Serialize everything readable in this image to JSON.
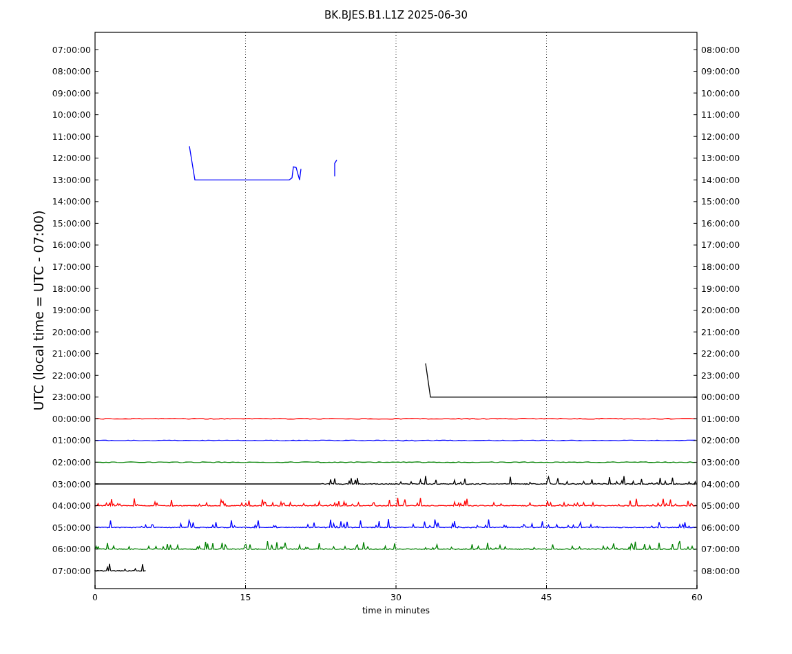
{
  "title": "BK.BJES.B1.L1Z 2025-06-30",
  "ylabel": "UTC (local time = UTC - 07:00)",
  "xlabel": "time in minutes",
  "xticks": [
    "0",
    "15",
    "30",
    "45",
    "60"
  ],
  "rows": [
    {
      "left": "07:00:00",
      "right": "08:00:00"
    },
    {
      "left": "08:00:00",
      "right": "09:00:00"
    },
    {
      "left": "09:00:00",
      "right": "10:00:00"
    },
    {
      "left": "10:00:00",
      "right": "11:00:00"
    },
    {
      "left": "11:00:00",
      "right": "12:00:00"
    },
    {
      "left": "12:00:00",
      "right": "13:00:00"
    },
    {
      "left": "13:00:00",
      "right": "14:00:00",
      "trace": {
        "kind": "drop-segment",
        "color": "#0000ff"
      }
    },
    {
      "left": "14:00:00",
      "right": "15:00:00"
    },
    {
      "left": "15:00:00",
      "right": "16:00:00"
    },
    {
      "left": "16:00:00",
      "right": "17:00:00"
    },
    {
      "left": "17:00:00",
      "right": "18:00:00"
    },
    {
      "left": "18:00:00",
      "right": "19:00:00"
    },
    {
      "left": "19:00:00",
      "right": "20:00:00"
    },
    {
      "left": "20:00:00",
      "right": "21:00:00"
    },
    {
      "left": "21:00:00",
      "right": "22:00:00"
    },
    {
      "left": "22:00:00",
      "right": "23:00:00"
    },
    {
      "left": "23:00:00",
      "right": "00:00:00",
      "trace": {
        "kind": "drop-tail",
        "color": "#000000"
      }
    },
    {
      "left": "00:00:00",
      "right": "01:00:00",
      "trace": {
        "kind": "flat",
        "color": "#ff0000"
      }
    },
    {
      "left": "01:00:00",
      "right": "02:00:00",
      "trace": {
        "kind": "flat",
        "color": "#0000ff"
      }
    },
    {
      "left": "02:00:00",
      "right": "03:00:00",
      "trace": {
        "kind": "flat",
        "color": "#008000"
      }
    },
    {
      "left": "03:00:00",
      "right": "04:00:00",
      "trace": {
        "kind": "quiet-then-spiky",
        "color": "#000000"
      }
    },
    {
      "left": "04:00:00",
      "right": "05:00:00",
      "trace": {
        "kind": "spiky",
        "color": "#ff0000"
      }
    },
    {
      "left": "05:00:00",
      "right": "06:00:00",
      "trace": {
        "kind": "spiky",
        "color": "#0000ff"
      }
    },
    {
      "left": "06:00:00",
      "right": "07:00:00",
      "trace": {
        "kind": "spiky",
        "color": "#008000"
      }
    },
    {
      "left": "07:00:00",
      "right": "08:00:00",
      "trace": {
        "kind": "short-spiky",
        "color": "#000000"
      }
    }
  ]
}
